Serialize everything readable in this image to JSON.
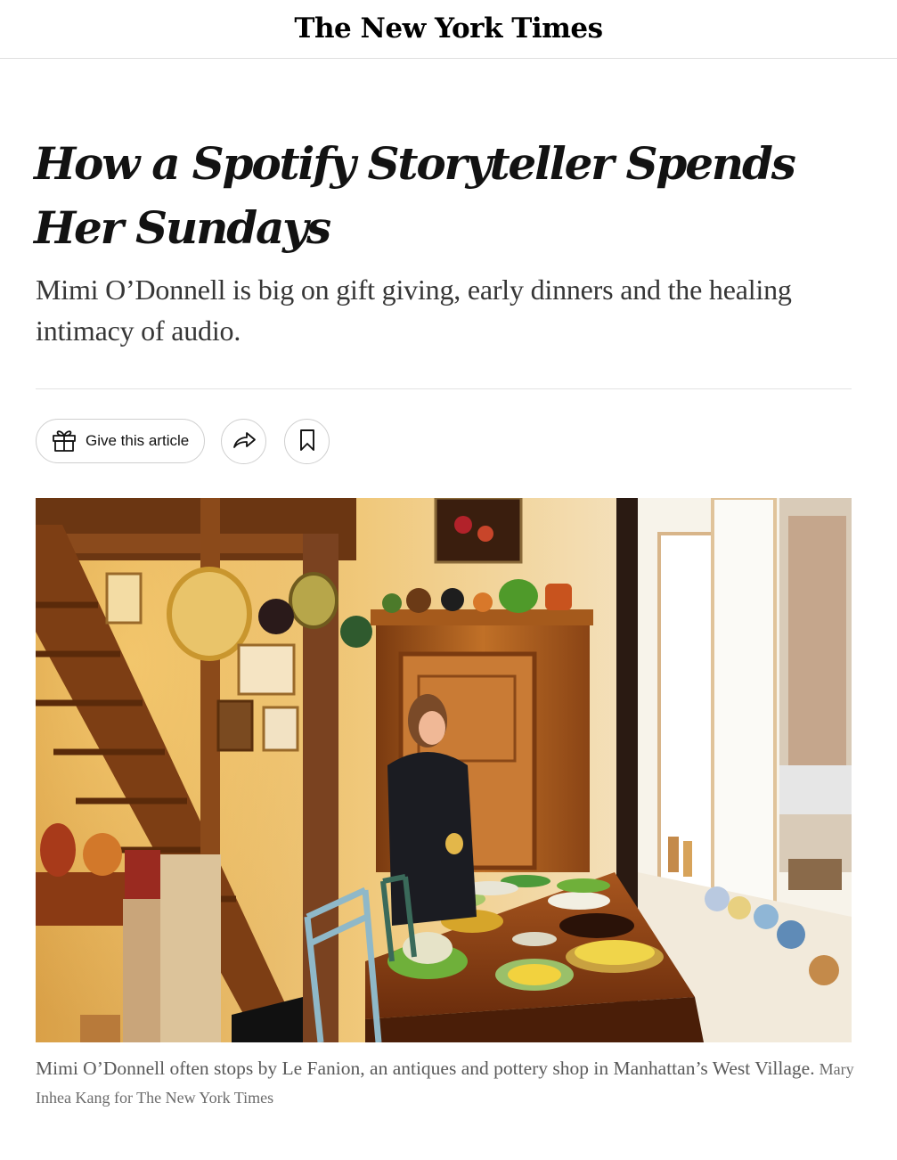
{
  "masthead": {
    "logo": "The New York Times"
  },
  "article": {
    "headline": "How a Spotify Storyteller Spends Her Sundays",
    "summary": "Mimi O’Donnell is big on gift giving, early dinners and the healing intimacy of audio.",
    "tools": {
      "gift_label": "Give this article",
      "gift_icon": "gift-icon",
      "share_icon": "share-arrow-icon",
      "save_icon": "bookmark-icon"
    },
    "image": {
      "caption": "Mimi O’Donnell often stops by Le Fanion, an antiques and pottery shop in Manhattan’s West Village.",
      "credit": "Mary Inhea Kang for The New York Times"
    }
  }
}
